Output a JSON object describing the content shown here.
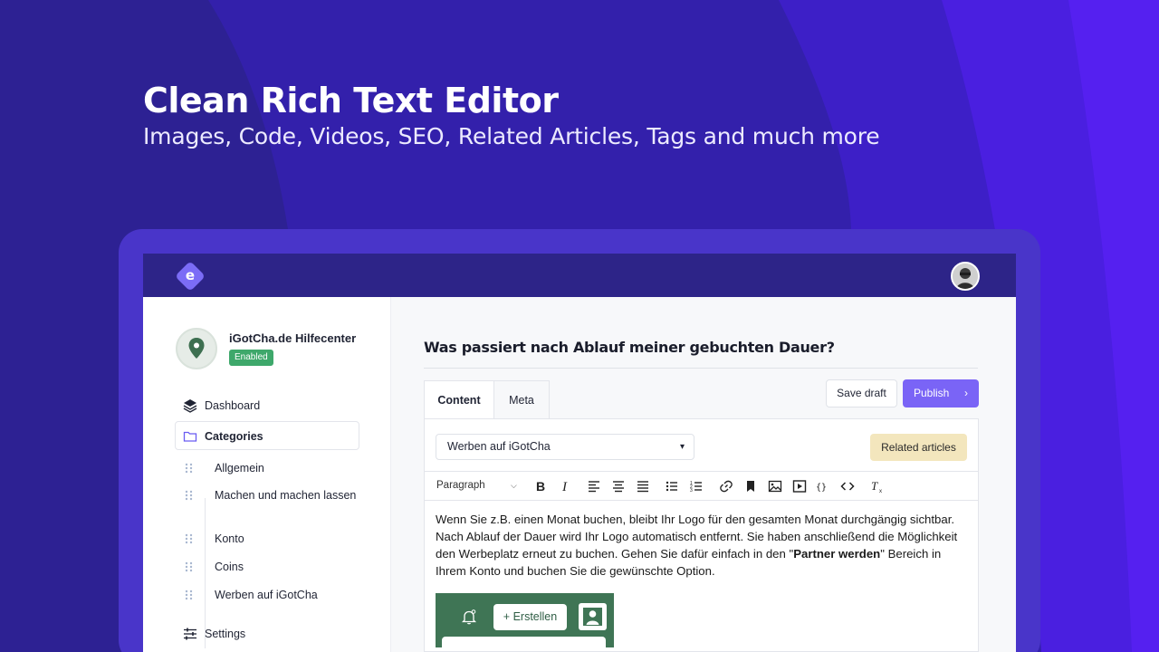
{
  "hero": {
    "title": "Clean Rich Text Editor",
    "subtitle": "Images, Code, Videos, SEO, Related Articles, Tags and much more"
  },
  "app": {
    "logo_letter": "e"
  },
  "workspace": {
    "name": "iGotCha.de Hilfecenter",
    "status": "Enabled"
  },
  "sidebar": {
    "dashboard": "Dashboard",
    "categories": "Categories",
    "category_items": [
      "Allgemein",
      "Machen und machen lassen",
      "Konto",
      "Coins",
      "Werben auf iGotCha"
    ],
    "settings": "Settings"
  },
  "article": {
    "title": "Was passiert nach Ablauf meiner gebuchten Dauer?"
  },
  "tabs": {
    "content": "Content",
    "meta": "Meta"
  },
  "actions": {
    "save_draft": "Save draft",
    "publish": "Publish",
    "related_articles": "Related articles"
  },
  "editor": {
    "category_value": "Werben auf iGotCha",
    "block_format": "Paragraph",
    "text_part1": "Wenn Sie z.B. einen Monat buchen, bleibt Ihr Logo für den gesamten Monat durchgängig sichtbar. Nach Ablauf der Dauer wird Ihr Logo automatisch entfernt. Sie haben anschließend die Möglichkeit den Werbeplatz erneut zu buchen. Gehen Sie dafür einfach in den \"",
    "text_bold": "Partner werden",
    "text_part2": "\" Bereich in Ihrem Konto und buchen Sie die gewünschte Option.",
    "image_button": "Erstellen",
    "image_button_plus": "+"
  },
  "toolbar_icons": [
    "bold-icon",
    "italic-icon",
    "align-left-icon",
    "align-center-icon",
    "align-justify-icon",
    "bullet-list-icon",
    "numbered-list-icon",
    "link-icon",
    "bookmark-icon",
    "image-icon",
    "video-icon",
    "code-block-icon",
    "inline-code-icon",
    "clear-format-icon"
  ],
  "colors": {
    "background": "#2e2196",
    "topbar": "#2d2488",
    "primary": "#7a64f6",
    "success": "#3ea86b",
    "related": "#f3e6bd",
    "preview_green": "#3f7555"
  }
}
